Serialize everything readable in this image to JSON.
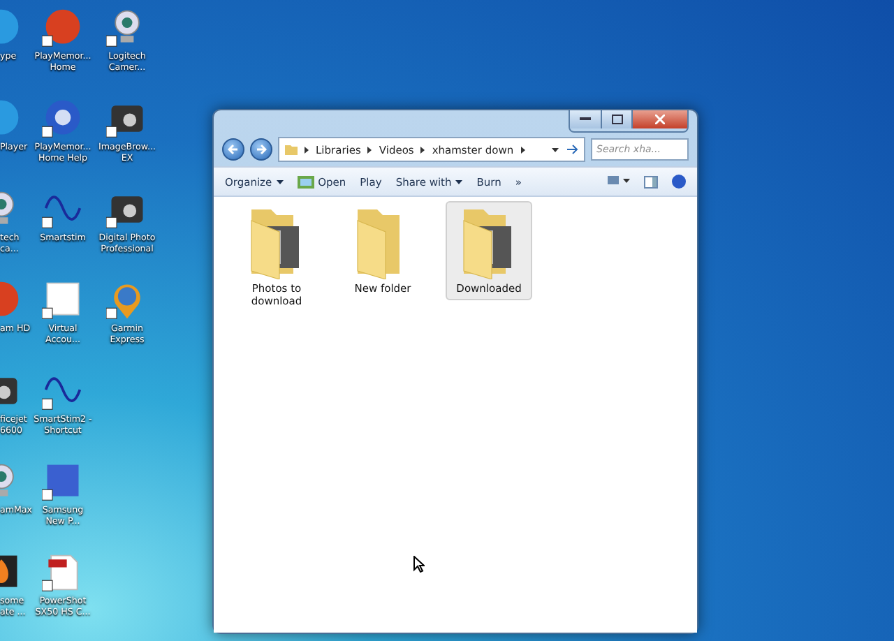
{
  "desktop_icons": [
    {
      "label": "ype",
      "kind": "s"
    },
    {
      "label": "PlayMemor...\nHome",
      "kind": "ball"
    },
    {
      "label": "Logitech\nCamer...",
      "kind": "webcam"
    },
    {
      "label": "Player",
      "kind": "s"
    },
    {
      "label": "PlayMemor...\nHome Help",
      "kind": "question"
    },
    {
      "label": "ImageBrow...\nEX",
      "kind": "camera"
    },
    {
      "label": "tech\nca...",
      "kind": "webcam"
    },
    {
      "label": "Smartstim",
      "kind": "wave"
    },
    {
      "label": "Digital Photo\nProfessional",
      "kind": "camera"
    },
    {
      "label": "am HD",
      "kind": "ball"
    },
    {
      "label": "Virtual\nAccou...",
      "kind": "tile"
    },
    {
      "label": "Garmin\nExpress",
      "kind": "globe"
    },
    {
      "label": "ficejet\n6600",
      "kind": "camera"
    },
    {
      "label": "SmartStim2 -\nShortcut",
      "kind": "wave"
    },
    {
      "kind": "none"
    },
    {
      "label": "amMax",
      "kind": "webcam"
    },
    {
      "label": "Samsung\nNew P...",
      "kind": "nps"
    },
    {
      "kind": "none"
    },
    {
      "label": "some\nate ...",
      "kind": "fire"
    },
    {
      "label": "PowerShot\nSX50 HS C...",
      "kind": "pdf"
    },
    {
      "kind": "none"
    }
  ],
  "window": {
    "breadcrumb": [
      "Libraries",
      "Videos",
      "xhamster down"
    ],
    "search": {
      "placeholder": "Search xha..."
    },
    "toolbar": [
      {
        "label": "Organize",
        "dropdown": true,
        "icon": false
      },
      {
        "label": "Open",
        "dropdown": false,
        "icon": true
      },
      {
        "label": "Play",
        "dropdown": false,
        "icon": false
      },
      {
        "label": "Share with",
        "dropdown": true,
        "icon": false
      },
      {
        "label": "Burn",
        "dropdown": false,
        "icon": false
      },
      {
        "label": "»",
        "dropdown": false,
        "icon": false
      }
    ],
    "items": [
      {
        "label": "Photos to\ndownload",
        "photos": true,
        "selected": false
      },
      {
        "label": "New folder",
        "photos": false,
        "selected": false
      },
      {
        "label": "Downloaded",
        "photos": true,
        "selected": true
      }
    ]
  }
}
